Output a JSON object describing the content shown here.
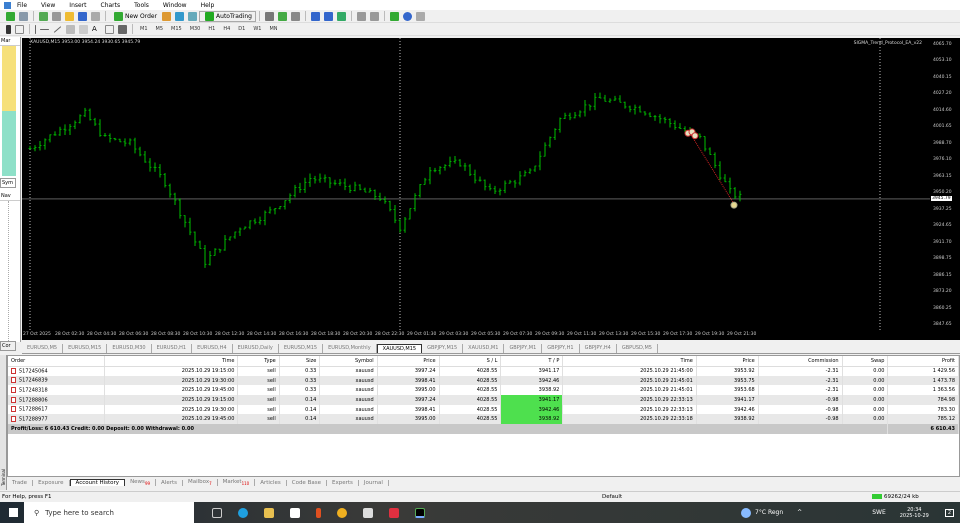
{
  "menu": [
    "File",
    "View",
    "Insert",
    "Charts",
    "Tools",
    "Window",
    "Help"
  ],
  "toolbar": {
    "new_order": "New Order",
    "autotrading": "AutoTrading",
    "timeframes": [
      "M1",
      "M5",
      "M15",
      "M30",
      "H1",
      "H4",
      "D1",
      "W1",
      "MN"
    ]
  },
  "left_panel": {
    "market_watch": "Mar",
    "symbols_tab": "Sym",
    "navigator": "Nav",
    "common": "Cor"
  },
  "chart": {
    "header": "XAUUSD,M15  3953.00 3954.24 3930.65 3945.79",
    "ea_label": "SIGMA_Trend_Protocol_EA_v22",
    "current_price": "3945.79",
    "bull_color": "#00c000",
    "price_labels": [
      "4065.70",
      "4053.10",
      "4040.15",
      "4027.20",
      "4014.60",
      "4001.65",
      "3988.70",
      "3976.10",
      "3963.15",
      "3950.20",
      "3937.25",
      "3924.65",
      "3911.70",
      "3898.75",
      "3886.15",
      "3873.20",
      "3860.25",
      "3847.65"
    ],
    "price_max": 4065.7,
    "price_min": 3847.65,
    "time_labels": [
      "27 Oct 2025",
      "28 Oct 02:30",
      "28 Oct 04:30",
      "28 Oct 06:30",
      "28 Oct 08:30",
      "28 Oct 10:30",
      "28 Oct 12:30",
      "28 Oct 14:30",
      "28 Oct 16:30",
      "28 Oct 18:30",
      "28 Oct 20:30",
      "28 Oct 22:30",
      "29 Oct 01:30",
      "29 Oct 03:30",
      "29 Oct 05:30",
      "29 Oct 07:30",
      "29 Oct 09:30",
      "29 Oct 11:30",
      "29 Oct 13:30",
      "29 Oct 15:30",
      "29 Oct 17:30",
      "29 Oct 19:30",
      "29 Oct 21:30"
    ],
    "price_path": [
      [
        0,
        3985
      ],
      [
        11,
        4012
      ],
      [
        15,
        3993
      ],
      [
        20,
        3989
      ],
      [
        27,
        3959
      ],
      [
        35,
        3897
      ],
      [
        42,
        3924
      ],
      [
        48,
        3936
      ],
      [
        56,
        3962
      ],
      [
        64,
        3955
      ],
      [
        70,
        3947
      ],
      [
        74,
        3924
      ],
      [
        80,
        3970
      ],
      [
        86,
        3974
      ],
      [
        92,
        3951
      ],
      [
        100,
        3966
      ],
      [
        106,
        4008
      ],
      [
        114,
        4024
      ],
      [
        122,
        4016
      ],
      [
        130,
        4001
      ],
      [
        134,
        3993
      ],
      [
        140,
        3951
      ],
      [
        142,
        3947
      ]
    ]
  },
  "chart_tabs": [
    "EURUSD,M5",
    "EURUSD,M15",
    "EURUSD,M30",
    "EURUSD,H1",
    "EURUSD,H4",
    "EURUSD,Daily",
    "EURUSD,M15",
    "EURUSD,Monthly",
    "XAUUSD,M15",
    "GBPJPY,M15",
    "XAUUSD,M1",
    "GBPJPY,M1",
    "GBPJPY,H1",
    "GBPJPY,H4",
    "GBPUSD,M5"
  ],
  "active_chart_tab": "XAUUSD,M15",
  "history": {
    "columns": [
      "Order",
      "Time",
      "Type",
      "Size",
      "Symbol",
      "Price",
      "S / L",
      "T / P",
      "Time",
      "Price",
      "Commission",
      "Swap",
      "Profit"
    ],
    "rows": [
      [
        "517245064",
        "2025.10.29 19:15:00",
        "sell",
        "0.33",
        "xauusd",
        "3997.24",
        "4028.55",
        "3941.17",
        "2025.10.29 21:45:00",
        "3953.92",
        "-2.31",
        "0.00",
        "1 429.56"
      ],
      [
        "517246839",
        "2025.10.29 19:30:00",
        "sell",
        "0.33",
        "xauusd",
        "3998.41",
        "4028.55",
        "3942.46",
        "2025.10.29 21:45:01",
        "3953.75",
        "-2.31",
        "0.00",
        "1 473.78"
      ],
      [
        "517248318",
        "2025.10.29 19:45:00",
        "sell",
        "0.33",
        "xauusd",
        "3995.00",
        "4028.55",
        "3938.92",
        "2025.10.29 21:45:01",
        "3953.68",
        "-2.31",
        "0.00",
        "1 363.56"
      ],
      [
        "517288806",
        "2025.10.29 19:15:00",
        "sell",
        "0.14",
        "xauusd",
        "3997.24",
        "4028.55",
        "3941.17",
        "2025.10.29 22:33:13",
        "3941.17",
        "-0.98",
        "0.00",
        "784.98"
      ],
      [
        "517288617",
        "2025.10.29 19:30:00",
        "sell",
        "0.14",
        "xauusd",
        "3998.41",
        "4028.55",
        "3942.46",
        "2025.10.29 22:33:13",
        "3942.46",
        "-0.98",
        "0.00",
        "783.30"
      ],
      [
        "517288977",
        "2025.10.29 19:45:00",
        "sell",
        "0.14",
        "xauusd",
        "3995.00",
        "4028.55",
        "3938.92",
        "2025.10.29 22:33:18",
        "3938.92",
        "-0.98",
        "0.00",
        "785.12"
      ]
    ],
    "tp_hit_rows": [
      3,
      4,
      5
    ],
    "summary": "Profit/Loss: 6 610.43  Credit: 0.00  Deposit: 0.00  Withdrawal: 0.00",
    "total": "6 610.43"
  },
  "terminal_tabs": [
    {
      "label": "Trade"
    },
    {
      "label": "Exposure"
    },
    {
      "label": "Account History",
      "active": true
    },
    {
      "label": "News",
      "badge": "99"
    },
    {
      "label": "Alerts"
    },
    {
      "label": "Mailbox",
      "badge": "7"
    },
    {
      "label": "Market",
      "badge": "110"
    },
    {
      "label": "Articles"
    },
    {
      "label": "Code Base"
    },
    {
      "label": "Experts"
    },
    {
      "label": "Journal"
    }
  ],
  "terminal_label": "Terminal",
  "status": {
    "help": "For Help, press F1",
    "profile": "Default",
    "traffic": "69262/24 kb"
  },
  "taskbar": {
    "search_placeholder": "Type here to search",
    "weather": "7°C  Regn",
    "lang": "SWE",
    "time": "20:34",
    "date": "2025-10-29",
    "notifications": "2"
  }
}
